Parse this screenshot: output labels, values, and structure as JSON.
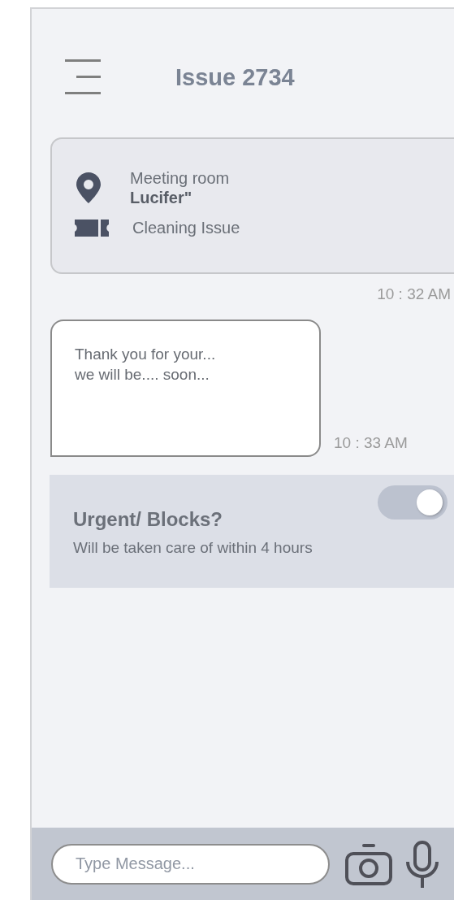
{
  "header": {
    "title": "Issue 2734"
  },
  "issue_card": {
    "location_line1": "Meeting room",
    "location_line2": "Lucifer\"",
    "category": "Cleaning Issue",
    "time": "10 : 32 AM"
  },
  "message": {
    "text": "Thank you for your...\nwe will be.... soon...",
    "time": "10 : 33 AM"
  },
  "urgent": {
    "title": "Urgent/ Blocks?",
    "description": "Will be taken care of within 4 hours",
    "on": true
  },
  "composer": {
    "placeholder": "Type Message..."
  }
}
